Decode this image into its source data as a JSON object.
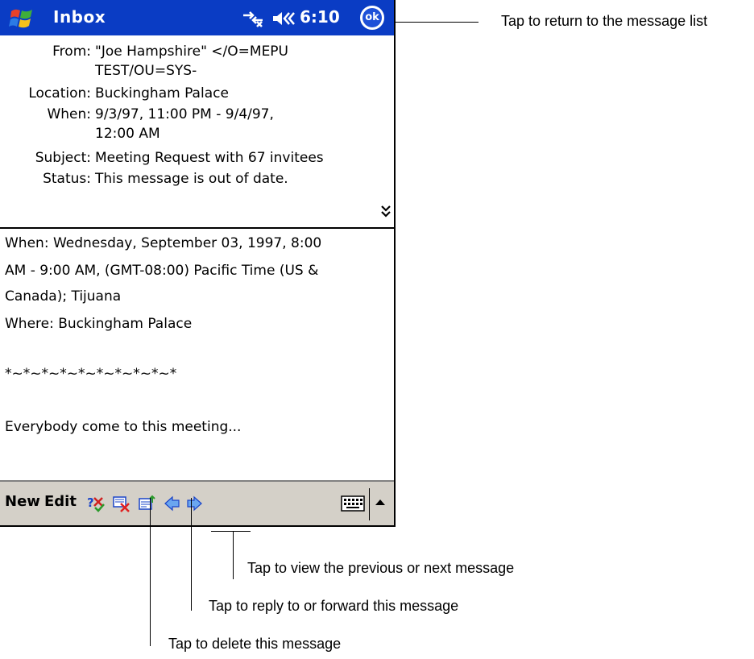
{
  "titlebar": {
    "title": "Inbox",
    "time": "6:10",
    "ok_label": "ok",
    "colors": {
      "background": "#0a3cc4",
      "text": "#ffffff"
    }
  },
  "header": {
    "from_label": "From:",
    "from_value_line1": "\"Joe Hampshire\" </O=MEPU",
    "from_value_line2": "TEST/OU=SYS-",
    "location_label": "Location:",
    "location_value": "Buckingham Palace",
    "when_label": "When:",
    "when_value_line1": "9/3/97, 11:00 PM - 9/4/97,",
    "when_value_line2": "12:00 AM",
    "subject_label": "Subject:",
    "subject_value": "Meeting Request with 67 invitees",
    "status_label": "Status:",
    "status_value": "This message is out of date."
  },
  "body": {
    "lines": [
      "When: Wednesday, September 03, 1997, 8:00",
      "AM - 9:00 AM, (GMT-08:00) Pacific Time (US &",
      "Canada); Tijuana",
      "Where: Buckingham Palace",
      "*~*~*~*~*~*~*~*~*~*",
      "Everybody come to this meeting..."
    ]
  },
  "toolbar": {
    "new_label": "New",
    "edit_label": "Edit"
  },
  "callouts": {
    "return_to_list": "Tap to return to the message list",
    "prev_next": "Tap to view the previous or next message",
    "reply_forward": "Tap to reply to or forward this message",
    "delete": "Tap to delete this message"
  }
}
